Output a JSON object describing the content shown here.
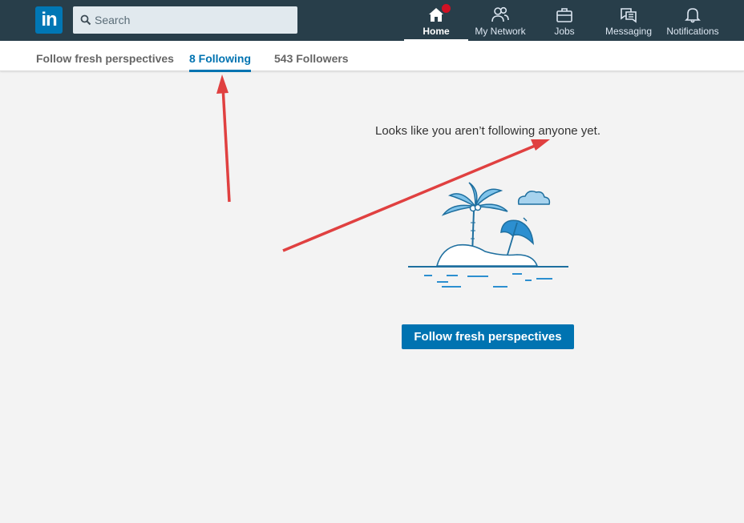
{
  "brand": {
    "logo_text": "in",
    "color": "#0077b5"
  },
  "search": {
    "placeholder": "Search",
    "icon": "search-icon"
  },
  "nav": {
    "items": [
      {
        "label": "Home",
        "icon": "home-icon",
        "active": true,
        "has_badge": true
      },
      {
        "label": "My Network",
        "icon": "people-icon"
      },
      {
        "label": "Jobs",
        "icon": "briefcase-icon"
      },
      {
        "label": "Messaging",
        "icon": "chat-icon"
      },
      {
        "label": "Notifications",
        "icon": "bell-icon"
      }
    ]
  },
  "tabs": [
    {
      "label": "Follow fresh perspectives"
    },
    {
      "label": "8 Following",
      "active": true
    },
    {
      "label": "543 Followers"
    }
  ],
  "main": {
    "empty_message": "Looks like you aren’t following anyone yet.",
    "cta_label": "Follow fresh perspectives",
    "illustration": "island-illustration"
  },
  "colors": {
    "nav_bg": "#283e4a",
    "accent": "#0073b1",
    "badge": "#d11124",
    "annotation_arrow": "#e04040"
  }
}
